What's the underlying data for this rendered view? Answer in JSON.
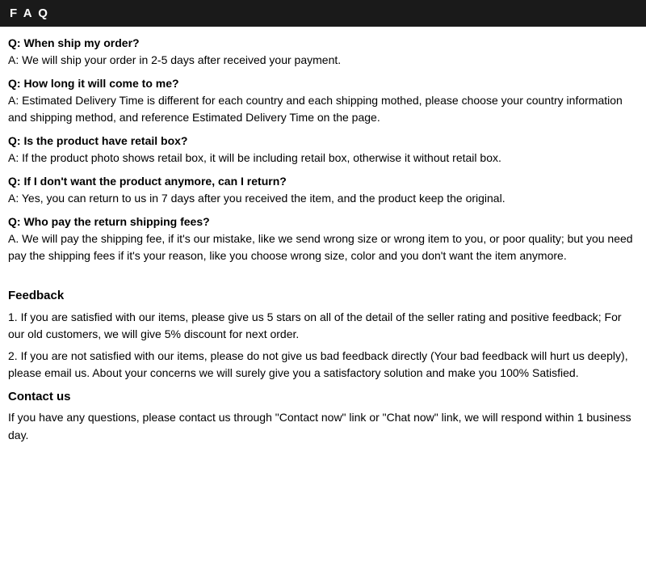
{
  "header": {
    "title": "F A Q"
  },
  "faq": {
    "items": [
      {
        "question": "Q: When ship my order?",
        "answer": "A: We will ship your order in 2-5 days after received your payment."
      },
      {
        "question": "Q: How long it will come to me?",
        "answer": "A: Estimated Delivery Time is different for each country and each shipping mothed, please choose your country information and shipping method, and reference Estimated Delivery Time on the page."
      },
      {
        "question": "Q: Is the product have retail box?",
        "answer": "A: If the product photo shows retail box, it will be including retail box, otherwise it without retail box."
      },
      {
        "question": "Q: If I don't want the product anymore, can I return?",
        "answer": "A: Yes, you can return to us in 7 days after you received the item, and the product keep the original."
      },
      {
        "question": "Q: Who pay the return shipping fees?",
        "answer": "A. We will pay the shipping fee, if it's our mistake, like we send wrong size or wrong item to you, or poor quality; but you need pay the shipping fees if it's your reason, like you choose wrong size, color and you don't want the item anymore."
      }
    ]
  },
  "feedback": {
    "title": "Feedback",
    "items": [
      "1.  If you are satisfied with our items, please give us 5 stars on all of the detail of the seller rating and positive feedback; For our old customers, we will give 5% discount for next order.",
      "2.  If you are not satisfied with our items, please do not give us bad feedback directly (Your bad feedback will hurt us deeply), please email us. About your concerns we will surely give you a satisfactory solution and make you 100% Satisfied."
    ]
  },
  "contact": {
    "title": "Contact us",
    "text": "If you have any questions, please contact us through \"Contact now\" link or \"Chat now\" link, we will respond within 1 business day."
  }
}
